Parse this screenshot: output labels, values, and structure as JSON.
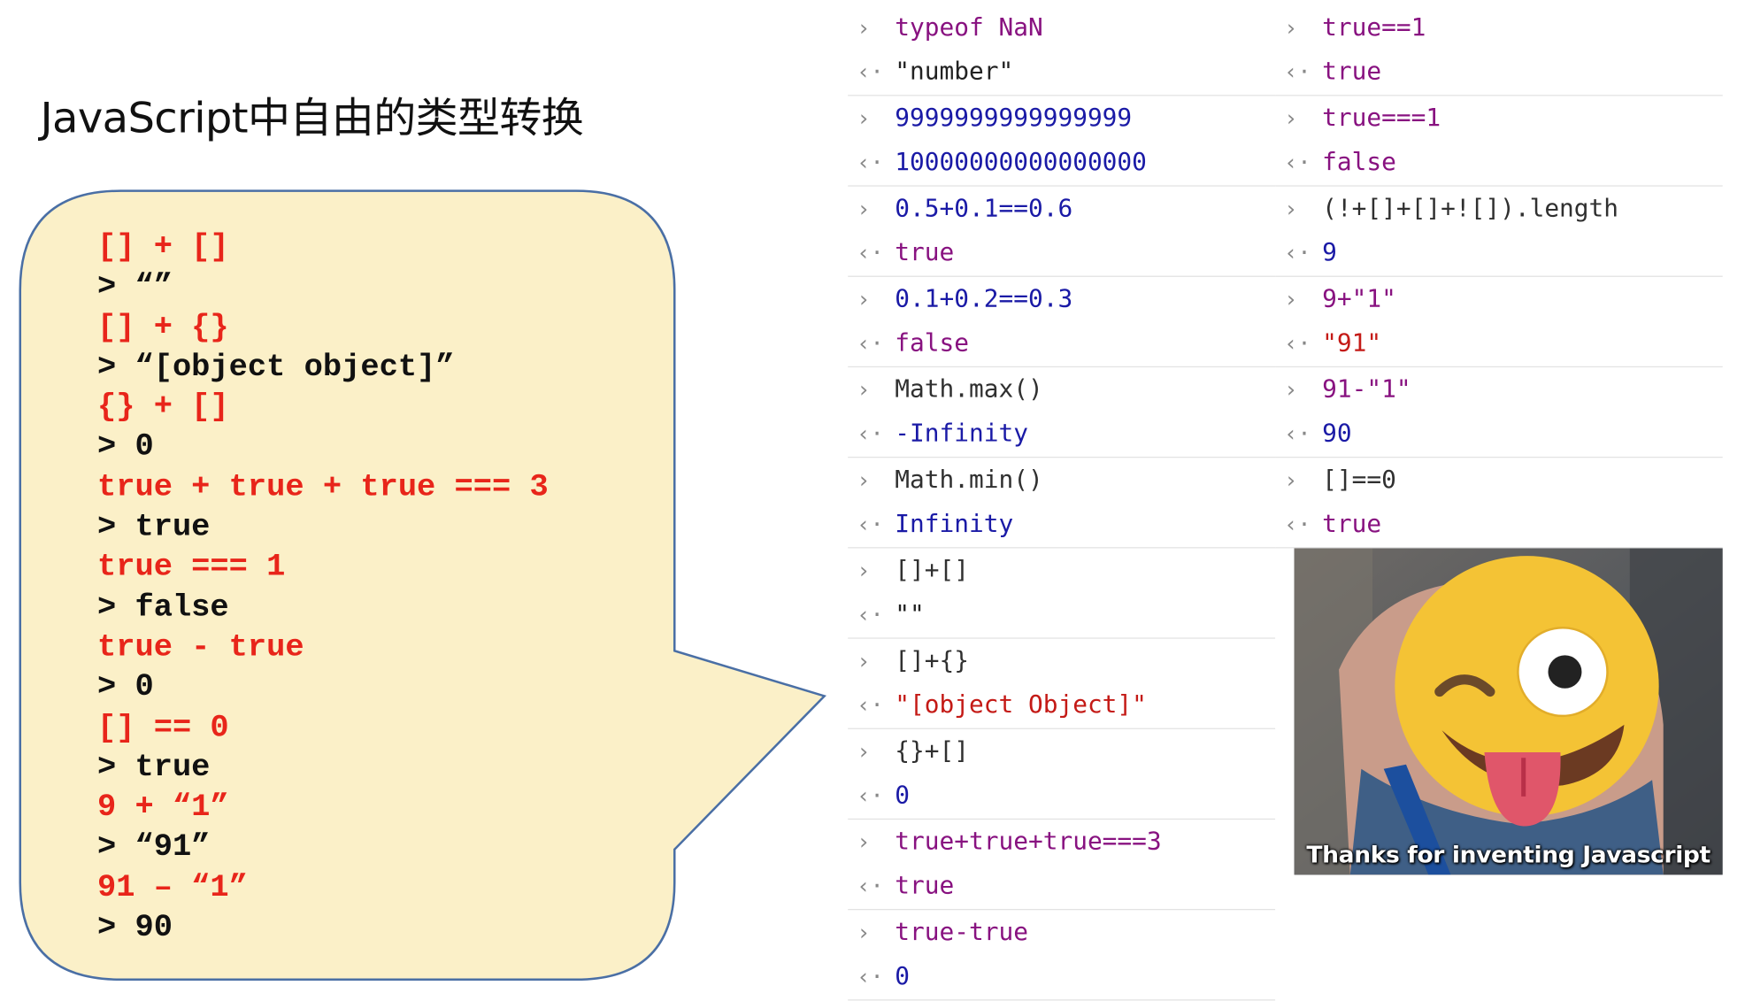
{
  "title": "JavaScript中自由的类型转换",
  "bubble": {
    "lines": [
      {
        "kind": "in",
        "text": "[] + []"
      },
      {
        "kind": "out",
        "text": "> “”"
      },
      {
        "kind": "in",
        "text": "[] + {}"
      },
      {
        "kind": "out",
        "text": "> “[object object]”"
      },
      {
        "kind": "in",
        "text": "{} + []"
      },
      {
        "kind": "out",
        "text": "> 0"
      },
      {
        "kind": "in",
        "text": "true + true + true === 3"
      },
      {
        "kind": "out",
        "text": "> true"
      },
      {
        "kind": "in",
        "text": "true === 1"
      },
      {
        "kind": "out",
        "text": "> false"
      },
      {
        "kind": "in",
        "text": "true - true"
      },
      {
        "kind": "out",
        "text": "> 0"
      },
      {
        "kind": "in",
        "text": "[] == 0"
      },
      {
        "kind": "out",
        "text": "> true"
      },
      {
        "kind": "in",
        "text": "9 + “1”"
      },
      {
        "kind": "out",
        "text": "> “91”"
      },
      {
        "kind": "in",
        "text": "91 – “1”"
      },
      {
        "kind": "out",
        "text": "> 90"
      }
    ]
  },
  "console_left": [
    {
      "input": "typeof NaN",
      "output": "\"number\"",
      "in_color": "purple",
      "out_color": "dark"
    },
    {
      "input": "9999999999999999",
      "output": "10000000000000000",
      "in_color": "blue",
      "out_color": "blue"
    },
    {
      "input": "0.5+0.1==0.6",
      "output": "true",
      "in_color": "blue",
      "out_color": "purple"
    },
    {
      "input": "0.1+0.2==0.3",
      "output": "false",
      "in_color": "blue",
      "out_color": "purple"
    },
    {
      "input": "Math.max()",
      "output": "-Infinity",
      "in_color": "black",
      "out_color": "blue"
    },
    {
      "input": "Math.min()",
      "output": "Infinity",
      "in_color": "black",
      "out_color": "blue"
    },
    {
      "input": "[]+[]",
      "output": "\"\"",
      "in_color": "black",
      "out_color": "dark"
    },
    {
      "input": "[]+{}",
      "output": "\"[object Object]\"",
      "in_color": "black",
      "out_color": "red"
    },
    {
      "input": "{}+[]",
      "output": "0",
      "in_color": "black",
      "out_color": "blue"
    },
    {
      "input": "true+true+true===3",
      "output": "true",
      "in_color": "purple",
      "out_color": "purple"
    },
    {
      "input": "true-true",
      "output": "0",
      "in_color": "purple",
      "out_color": "blue"
    }
  ],
  "console_right": [
    {
      "input": "true==1",
      "output": "true",
      "in_color": "purple",
      "out_color": "purple"
    },
    {
      "input": "true===1",
      "output": "false",
      "in_color": "purple",
      "out_color": "purple"
    },
    {
      "input": "(!+[]+[]+![]).length",
      "output": "9",
      "in_color": "black",
      "out_color": "blue"
    },
    {
      "input": "9+\"1\"",
      "output": "\"91\"",
      "in_color": "purple",
      "out_color": "red"
    },
    {
      "input": "91-\"1\"",
      "output": "90",
      "in_color": "purple",
      "out_color": "blue"
    },
    {
      "input": "[]==0",
      "output": "true",
      "in_color": "black",
      "out_color": "purple"
    }
  ],
  "icons": {
    "input_prompt": "chevron-right-icon",
    "output_result": "chevron-left-dot-icon"
  },
  "colors": {
    "bubble_fill": "#fbf0c8",
    "bubble_stroke": "#4a6fa5",
    "code_red": "#e8251a",
    "console_purple": "#881280",
    "console_blue": "#1a1aa6",
    "console_red": "#c41a16",
    "emoji_yellow": "#f4c335"
  },
  "meme": {
    "caption": "Thanks for inventing Javascript",
    "emoji": "winking-face-with-tongue"
  }
}
